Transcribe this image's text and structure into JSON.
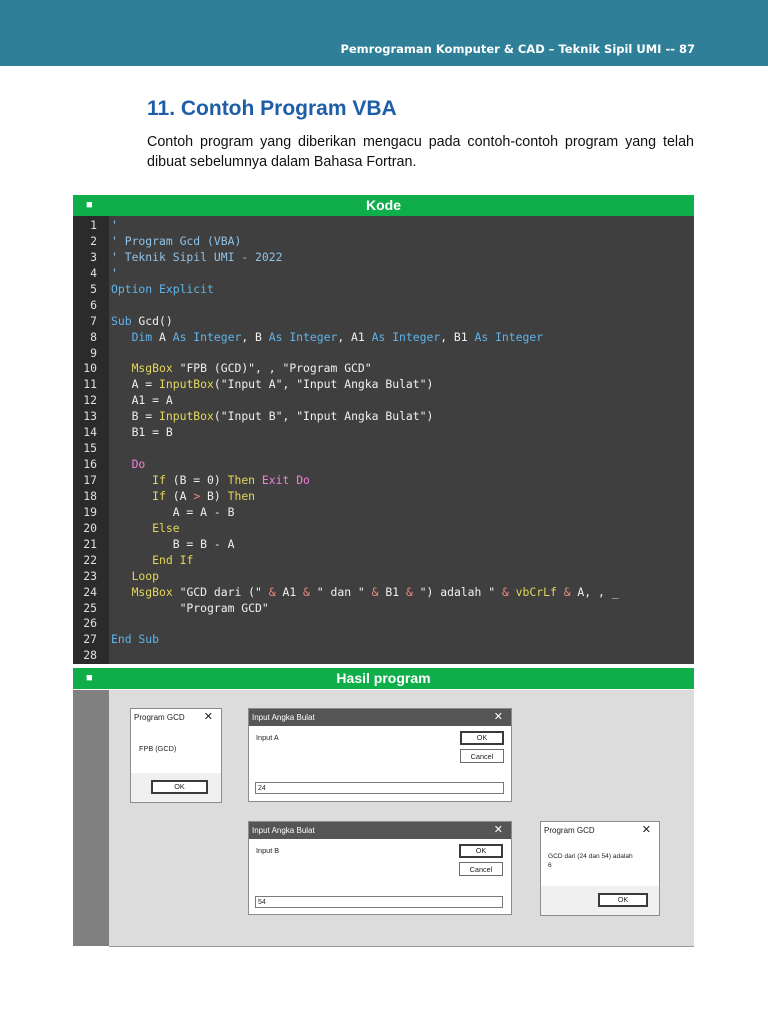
{
  "header": {
    "text": "Pemrograman Komputer & CAD – Teknik Sipil UMI -- 87"
  },
  "section": {
    "title": "11. Contoh Program VBA",
    "intro": "Contoh program yang diberikan mengacu pada contoh-contoh program yang telah dibuat sebelumnya dalam Bahasa Fortran."
  },
  "code_bar": {
    "bullet": "■",
    "label": "Kode"
  },
  "result_bar": {
    "bullet": "■",
    "label": "Hasil program"
  },
  "code_lines": [
    {
      "n": "1",
      "t": "'"
    },
    {
      "n": "2",
      "t": "' Program Gcd (VBA)"
    },
    {
      "n": "3",
      "t": "' Teknik Sipil UMI - 2022"
    },
    {
      "n": "4",
      "t": "'"
    },
    {
      "n": "5",
      "t": "Option Explicit"
    },
    {
      "n": "6",
      "t": ""
    },
    {
      "n": "7",
      "t": "Sub Gcd()"
    },
    {
      "n": "8",
      "t": "   Dim A As Integer, B As Integer, A1 As Integer, B1 As Integer"
    },
    {
      "n": "9",
      "t": ""
    },
    {
      "n": "10",
      "t": "   MsgBox \"FPB (GCD)\", , \"Program GCD\""
    },
    {
      "n": "11",
      "t": "   A = InputBox(\"Input A\", \"Input Angka Bulat\")"
    },
    {
      "n": "12",
      "t": "   A1 = A"
    },
    {
      "n": "13",
      "t": "   B = InputBox(\"Input B\", \"Input Angka Bulat\")"
    },
    {
      "n": "14",
      "t": "   B1 = B"
    },
    {
      "n": "15",
      "t": ""
    },
    {
      "n": "16",
      "t": "   Do"
    },
    {
      "n": "17",
      "t": "      If (B = 0) Then Exit Do"
    },
    {
      "n": "18",
      "t": "      If (A > B) Then"
    },
    {
      "n": "19",
      "t": "         A = A - B"
    },
    {
      "n": "20",
      "t": "      Else"
    },
    {
      "n": "21",
      "t": "         B = B - A"
    },
    {
      "n": "22",
      "t": "      End If"
    },
    {
      "n": "23",
      "t": "   Loop"
    },
    {
      "n": "24",
      "t": "   MsgBox \"GCD dari (\" & A1 & \" dan \" & B1 & \") adalah \" & vbCrLf & A, , _"
    },
    {
      "n": "25",
      "t": "          \"Program GCD\""
    },
    {
      "n": "26",
      "t": ""
    },
    {
      "n": "27",
      "t": "End Sub"
    },
    {
      "n": "28",
      "t": ""
    }
  ],
  "dialogs": {
    "msg1": {
      "title": "Program GCD",
      "close": "✕",
      "message": "FPB (GCD)",
      "ok": "OK"
    },
    "inputA": {
      "title": "Input Angka Bulat",
      "close": "✕",
      "prompt": "Input A",
      "ok": "OK",
      "cancel": "Cancel",
      "value": "24"
    },
    "inputB": {
      "title": "Input Angka Bulat",
      "close": "✕",
      "prompt": "Input B",
      "ok": "OK",
      "cancel": "Cancel",
      "value": "54"
    },
    "msg2": {
      "title": "Program GCD",
      "close": "✕",
      "message_line1": "GCD dari (24 dan 54) adalah",
      "message_line2": "6",
      "ok": "OK"
    }
  },
  "colors": {
    "header_bg": "#2e7f97",
    "title": "#1e5ea8",
    "bar_bg": "#0fae4b",
    "code_bg": "#3f3f3f",
    "keyword": "#5fb3ea",
    "function": "#e5d65a",
    "control": "#f37fd9",
    "operator": "#ec8b80"
  }
}
